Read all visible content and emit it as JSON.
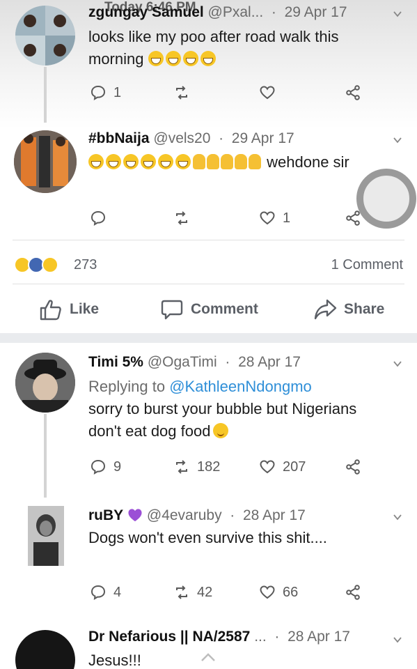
{
  "status_overlay": "Today 6:46 PM",
  "tweets": [
    {
      "name": "zgungay Samuel",
      "handle": "@Pxal...",
      "date": "29 Apr 17",
      "text_line1": "looks like my poo after road walk this",
      "text_line2": "morning",
      "emojis_line2": [
        "grinning-squint",
        "grinning-squint",
        "grinning-squint",
        "grinning-squint"
      ],
      "reply_count": "1",
      "retweet_count": "",
      "like_count": ""
    },
    {
      "name": "#bbNaija",
      "handle": "@vels20",
      "date": "29 Apr 17",
      "text": "wehdone sir",
      "emojis": [
        "grinning-squint",
        "grinning-squint",
        "grinning-squint",
        "grinning-squint",
        "grinning-squint",
        "grinning-squint",
        "clap",
        "clap",
        "clap",
        "clap",
        "clap"
      ],
      "reply_count": "",
      "retweet_count": "",
      "like_count": "1"
    },
    {
      "name": "Timi 5%",
      "handle": "@OgaTimi",
      "date": "28 Apr 17",
      "replying_prefix": "Replying to",
      "replying_to": "@KathleenNdongmo",
      "text_line1": "sorry to burst your bubble but Nigerians",
      "text_line2": "don't eat dog food",
      "reply_count": "9",
      "retweet_count": "182",
      "like_count": "207"
    },
    {
      "name": "ruBY",
      "name_icon": "purple-heart",
      "handle": "@4evaruby",
      "date": "28 Apr 17",
      "text": "Dogs won't even survive this shit....",
      "reply_count": "4",
      "retweet_count": "42",
      "like_count": "66"
    },
    {
      "name": "Dr Nefarious || NA/2587",
      "handle": "...",
      "date": "28 Apr 17",
      "text": "Jesus!!!"
    }
  ],
  "facebook": {
    "reaction_count": "273",
    "reaction_icons": [
      "haha",
      "like",
      "wow"
    ],
    "comments_label": "1 Comment",
    "like_label": "Like",
    "comment_label": "Comment",
    "share_label": "Share",
    "colors": {
      "like_blue": "#4267b2",
      "text_gray": "#5b5f66",
      "band_gray": "#e9ebee"
    }
  },
  "colors": {
    "mention_blue": "#2f8fd8",
    "meta_gray": "#6b6b6b"
  }
}
